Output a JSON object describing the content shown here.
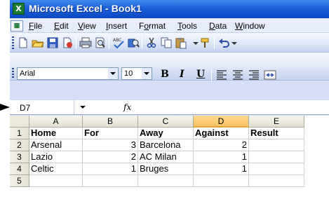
{
  "window": {
    "title": "Microsoft Excel - Book1",
    "app_icon": "X"
  },
  "menu": [
    "File",
    "Edit",
    "View",
    "Insert",
    "Format",
    "Tools",
    "Data",
    "Window"
  ],
  "menu_underline": [
    "F",
    "E",
    "V",
    "I",
    "o",
    "T",
    "D",
    "W"
  ],
  "toolbar": {
    "icons": [
      "new-icon",
      "open-icon",
      "save-icon",
      "permission-icon",
      "print-icon",
      "print-preview-icon",
      "spelling-icon",
      "research-icon",
      "cut-icon",
      "copy-icon",
      "paste-icon",
      "format-painter-icon",
      "undo-icon"
    ]
  },
  "format": {
    "font": "Arial",
    "size": "10",
    "bold": "B",
    "italic": "I",
    "underline": "U"
  },
  "formula_bar": {
    "name_box": "D7",
    "fx": "fx",
    "content": ""
  },
  "sheet": {
    "columns": [
      "A",
      "B",
      "C",
      "D",
      "E"
    ],
    "selected_column": "D",
    "rows": [
      "1",
      "2",
      "3",
      "4",
      "5"
    ],
    "cells": [
      [
        "Home",
        "For",
        "Away",
        "Against",
        "Result"
      ],
      [
        "Arsenal",
        "3",
        "Barcelona",
        "2",
        ""
      ],
      [
        "Lazio",
        "2",
        "AC Milan",
        "1",
        ""
      ],
      [
        "Celtic",
        "1",
        "Bruges",
        "1",
        ""
      ],
      [
        "",
        "",
        "",
        "",
        ""
      ]
    ]
  }
}
